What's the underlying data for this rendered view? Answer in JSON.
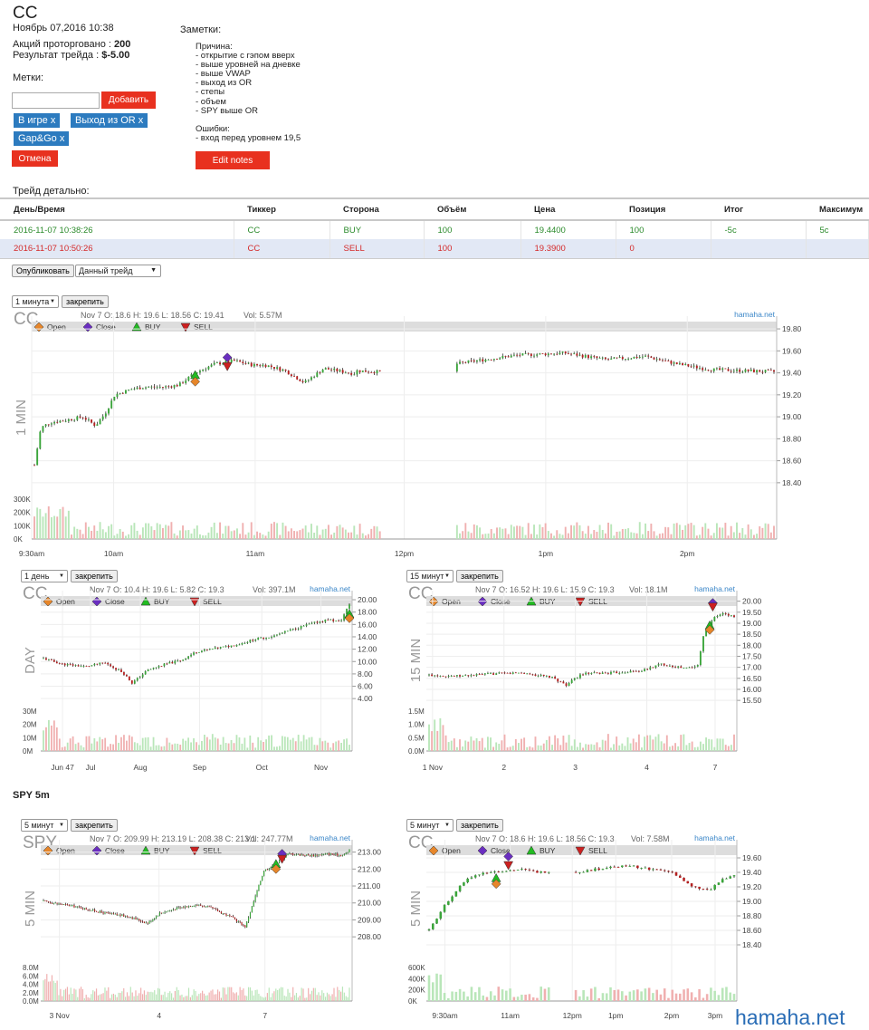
{
  "header": {
    "ticker": "CC",
    "date": "Ноябрь 07,2016 10:38",
    "shares_label": "Акций проторговано :",
    "shares_value": "200",
    "result_label": "Результат трейда :",
    "result_value": "$-5.00"
  },
  "tags": {
    "label": "Метки:",
    "input_value": "",
    "add_button": "Добавить",
    "items": [
      "В игре x",
      "Выход из OR x",
      "Gap&Go x"
    ],
    "cancel_button": "Отмена"
  },
  "notes": {
    "title": "Заметки:",
    "lines": [
      "Причина:",
      "- открытие с гэпом вверх",
      "- выше уровней на дневке",
      "- выше VWAP",
      "- выход из OR",
      "- степы",
      "- объем",
      "- SPY выше OR",
      "",
      "Ошибки:",
      "- вход перед уровнем 19,5"
    ],
    "edit_button": "Edit notes"
  },
  "trade": {
    "title": "Трейд детально:",
    "columns": [
      "День/Время",
      "Тиккер",
      "Сторона",
      "Объём",
      "Цена",
      "Позиция",
      "Итог",
      "Максимум"
    ],
    "rows": [
      [
        "2016-11-07 10:38:26",
        "CC",
        "BUY",
        "100",
        "19.4400",
        "100",
        "-5c",
        "5c"
      ],
      [
        "2016-11-07 10:50:26",
        "CC",
        "SELL",
        "100",
        "19.3900",
        "0",
        "",
        ""
      ]
    ]
  },
  "controls": {
    "publish_button": "Опубликовать",
    "scope_select": "Данный трейд"
  },
  "pin_label": "закрепить",
  "legend": {
    "open": "Open",
    "close": "Close",
    "buy": "BUY",
    "sell": "SELL"
  },
  "colors": {
    "up": "#3aa53a",
    "down": "#b52020",
    "wick": "#111",
    "buy": "#22bb22",
    "sell": "#cc2020",
    "open_marker": "#e6862a",
    "close_marker": "#6a2ec0",
    "volume": "#b9e6b9",
    "volume_down": "#f0b0b0"
  },
  "section_spy": "SPY 5m",
  "brand": "hamaha.net",
  "chart_data": [
    {
      "type": "candlestick",
      "ticker": "CC",
      "timeframe_label": "1 MIN",
      "select": "1 минута",
      "info": "Nov 7 O: 18.6 H: 19.6 L: 18.56 C: 19.41",
      "vol_info": "Vol: 5.57M",
      "watermark": "hamaha.net",
      "x_ticks": [
        "9:30am",
        "10am",
        "11am",
        "12pm",
        "1pm",
        "2pm"
      ],
      "y_ticks": [
        "19.80",
        "19.60",
        "19.40",
        "19.20",
        "19.00",
        "18.80",
        "18.60",
        "18.40"
      ],
      "ylim": [
        18.3,
        19.85
      ],
      "vol_ticks": [
        "300K",
        "200K",
        "100K",
        "0K"
      ],
      "vol_max": 320000,
      "gap": [
        0.47,
        0.57
      ],
      "path": [
        [
          0,
          18.56
        ],
        [
          0.02,
          18.9
        ],
        [
          0.05,
          18.95
        ],
        [
          0.1,
          18.97
        ],
        [
          0.15,
          19.0
        ],
        [
          0.19,
          18.92
        ],
        [
          0.22,
          19.03
        ],
        [
          0.25,
          19.2
        ],
        [
          0.3,
          19.25
        ],
        [
          0.34,
          19.27
        ],
        [
          0.4,
          19.27
        ],
        [
          0.45,
          19.29
        ],
        [
          0.5,
          19.4
        ],
        [
          0.56,
          19.48
        ],
        [
          0.62,
          19.51
        ],
        [
          0.68,
          19.47
        ],
        [
          0.72,
          19.47
        ],
        [
          0.78,
          19.42
        ],
        [
          0.84,
          19.31
        ],
        [
          0.9,
          19.44
        ],
        [
          1.0,
          19.39
        ],
        [
          1.0,
          19.42
        ],
        [
          1.12,
          19.4
        ],
        [
          1.25,
          19.45
        ],
        [
          1.35,
          19.5
        ],
        [
          1.5,
          19.56
        ],
        [
          1.65,
          19.58
        ],
        [
          1.78,
          19.52
        ],
        [
          1.9,
          19.55
        ],
        [
          2.0,
          19.48
        ],
        [
          2.1,
          19.43
        ],
        [
          2.2,
          19.42
        ],
        [
          2.3,
          19.41
        ]
      ],
      "markers": [
        {
          "t": 0.5,
          "kind": "buy",
          "price": 19.38
        },
        {
          "t": 0.5,
          "kind": "open",
          "price": 19.32
        },
        {
          "t": 0.6,
          "kind": "close",
          "price": 19.54
        },
        {
          "t": 0.6,
          "kind": "sell",
          "price": 19.46
        }
      ]
    },
    {
      "type": "candlestick",
      "ticker": "CC",
      "timeframe_label": "DAY",
      "select": "1 день",
      "info": "Nov 7 O: 10.4 H: 19.6 L: 5.82 C: 19.3",
      "vol_info": "Vol: 397.1M",
      "watermark": "hamaha.net",
      "x_ticks": [
        "Jun 47",
        "Jul",
        "Aug",
        "Sep",
        "Oct",
        "Nov"
      ],
      "y_ticks": [
        "20.00",
        "18.00",
        "16.00",
        "14.00",
        "12.00",
        "10.00",
        "8.00",
        "6.00",
        "4.00"
      ],
      "ylim": [
        3.0,
        20.3
      ],
      "vol_ticks": [
        "30M",
        "20M",
        "10M",
        "0M"
      ],
      "vol_max": 32000000,
      "path": [
        [
          0,
          10.5
        ],
        [
          0.06,
          9.6
        ],
        [
          0.14,
          9.2
        ],
        [
          0.2,
          9.8
        ],
        [
          0.26,
          8.2
        ],
        [
          0.29,
          6.5
        ],
        [
          0.34,
          8.6
        ],
        [
          0.4,
          9.6
        ],
        [
          0.45,
          10.2
        ],
        [
          0.5,
          11.6
        ],
        [
          0.56,
          12.1
        ],
        [
          0.63,
          12.7
        ],
        [
          0.69,
          13.6
        ],
        [
          0.75,
          14.1
        ],
        [
          0.82,
          15.3
        ],
        [
          0.88,
          16.2
        ],
        [
          0.93,
          16.8
        ],
        [
          0.97,
          16.4
        ],
        [
          1.0,
          19.3
        ]
      ],
      "markers": [
        {
          "t": 1.0,
          "kind": "buy",
          "price": 17.7
        },
        {
          "t": 1.0,
          "kind": "open",
          "price": 17.0
        }
      ]
    },
    {
      "type": "candlestick",
      "ticker": "CC",
      "timeframe_label": "15 MIN",
      "select": "15 минут",
      "info": "Nov 7 O: 16.52 H: 19.6 L: 15.9 C: 19.3",
      "vol_info": "Vol: 18.1M",
      "watermark": "hamaha.net",
      "x_ticks": [
        "1 Nov",
        "2",
        "3",
        "4",
        "7"
      ],
      "y_ticks": [
        "20.00",
        "19.50",
        "19.00",
        "18.50",
        "18.00",
        "17.50",
        "17.00",
        "16.50",
        "16.00",
        "15.50"
      ],
      "ylim": [
        15.3,
        20.15
      ],
      "vol_ticks": [
        "1.5M",
        "1.0M",
        "0.5M",
        "0.0M"
      ],
      "vol_max": 1600000,
      "path": [
        [
          0,
          16.65
        ],
        [
          0.1,
          16.6
        ],
        [
          0.2,
          16.7
        ],
        [
          0.3,
          16.75
        ],
        [
          0.4,
          16.55
        ],
        [
          0.45,
          16.2
        ],
        [
          0.5,
          16.7
        ],
        [
          0.6,
          16.75
        ],
        [
          0.7,
          16.85
        ],
        [
          0.76,
          17.15
        ],
        [
          0.84,
          16.95
        ],
        [
          0.88,
          17.05
        ],
        [
          0.9,
          18.5
        ],
        [
          0.93,
          19.2
        ],
        [
          0.96,
          19.45
        ],
        [
          1.0,
          19.3
        ]
      ],
      "markers": [
        {
          "t": 0.92,
          "kind": "buy",
          "price": 18.9
        },
        {
          "t": 0.92,
          "kind": "open",
          "price": 18.7
        },
        {
          "t": 0.93,
          "kind": "close",
          "price": 19.92
        },
        {
          "t": 0.93,
          "kind": "sell",
          "price": 19.75
        }
      ]
    },
    {
      "type": "candlestick",
      "ticker": "SPY",
      "timeframe_label": "5 MIN",
      "select": "5 минут",
      "info": "Nov 7 O: 209.99 H: 213.19 L: 208.38 C: 213.1",
      "vol_info": "Vol: 247.77M",
      "watermark": "hamaha.net",
      "x_ticks": [
        "3 Nov",
        "4",
        "7"
      ],
      "y_ticks": [
        "213.00",
        "212.00",
        "211.00",
        "210.00",
        "209.00",
        "208.00"
      ],
      "ylim": [
        207.1,
        213.3
      ],
      "vol_ticks": [
        "8.0M",
        "6.0M",
        "4.0M",
        "2.0M",
        "0.0M"
      ],
      "vol_max": 8500000,
      "path": [
        [
          0,
          210.1
        ],
        [
          0.1,
          209.8
        ],
        [
          0.2,
          209.4
        ],
        [
          0.28,
          209.2
        ],
        [
          0.34,
          208.8
        ],
        [
          0.38,
          209.4
        ],
        [
          0.44,
          209.7
        ],
        [
          0.5,
          209.9
        ],
        [
          0.55,
          209.7
        ],
        [
          0.62,
          209.1
        ],
        [
          0.66,
          208.6
        ],
        [
          0.72,
          211.9
        ],
        [
          0.76,
          212.3
        ],
        [
          0.8,
          212.9
        ],
        [
          0.88,
          212.8
        ],
        [
          0.93,
          212.9
        ],
        [
          0.98,
          212.8
        ],
        [
          1.0,
          213.1
        ]
      ],
      "markers": [
        {
          "t": 0.76,
          "kind": "buy",
          "price": 212.3
        },
        {
          "t": 0.76,
          "kind": "open",
          "price": 212.0
        },
        {
          "t": 0.78,
          "kind": "close",
          "price": 212.9
        },
        {
          "t": 0.78,
          "kind": "sell",
          "price": 212.6
        }
      ]
    },
    {
      "type": "candlestick",
      "ticker": "CC",
      "timeframe_label": "5 MIN",
      "select": "5 минут",
      "info": "Nov 7 O: 18.6 H: 19.6 L: 18.56 C: 19.3",
      "vol_info": "Vol: 7.58M",
      "watermark": "hamaha.net",
      "x_ticks": [
        "9:30am",
        "11am",
        "12pm",
        "1pm",
        "2pm",
        "3pm"
      ],
      "y_ticks": [
        "19.60",
        "19.40",
        "19.20",
        "19.00",
        "18.80",
        "18.60",
        "18.40"
      ],
      "ylim": [
        18.3,
        19.75
      ],
      "vol_ticks": [
        "600K",
        "400K",
        "200K",
        "0K"
      ],
      "vol_max": 620000,
      "gap": [
        0.4,
        0.48
      ],
      "path": [
        [
          0,
          18.6
        ],
        [
          0.06,
          19.0
        ],
        [
          0.12,
          19.3
        ],
        [
          0.18,
          19.4
        ],
        [
          0.24,
          19.42
        ],
        [
          0.3,
          19.44
        ],
        [
          0.36,
          19.4
        ],
        [
          0.4,
          19.42
        ],
        [
          0.48,
          19.4
        ],
        [
          0.56,
          19.45
        ],
        [
          0.64,
          19.5
        ],
        [
          0.72,
          19.45
        ],
        [
          0.8,
          19.4
        ],
        [
          0.86,
          19.2
        ],
        [
          0.92,
          19.15
        ],
        [
          0.96,
          19.3
        ],
        [
          1.0,
          19.35
        ]
      ],
      "markers": [
        {
          "t": 0.22,
          "kind": "buy",
          "price": 19.32
        },
        {
          "t": 0.22,
          "kind": "open",
          "price": 19.24
        },
        {
          "t": 0.26,
          "kind": "close",
          "price": 19.62
        },
        {
          "t": 0.26,
          "kind": "sell",
          "price": 19.5
        }
      ]
    }
  ]
}
